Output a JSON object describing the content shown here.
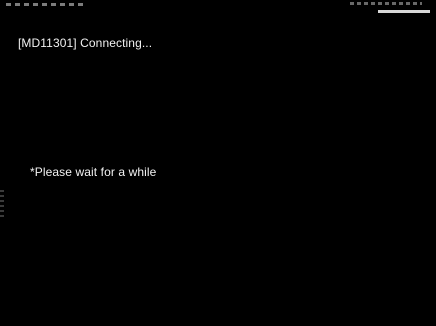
{
  "screen": {
    "status_message": "[MD11301] Connecting...",
    "wait_message": "*Please wait for a while"
  },
  "colors": {
    "background": "#000000",
    "text": "#f2f2f2"
  }
}
